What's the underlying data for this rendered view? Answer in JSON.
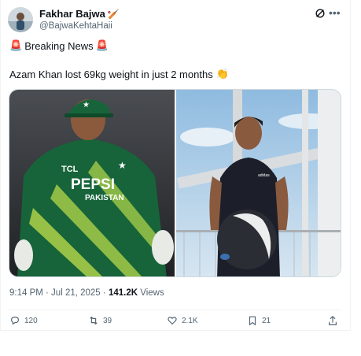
{
  "author": {
    "display_name": "Fakhar Bajwa",
    "handle": "@BajwaKehtaHaii",
    "name_emoji": "🏏"
  },
  "post": {
    "line1_prefix_emoji": "🚨",
    "line1_text": "Breaking News",
    "line1_suffix_emoji": "🚨",
    "line2_text": "Azam Khan lost 69kg weight in just 2 months",
    "line2_emoji": "👏",
    "timestamp": "9:14 PM · Jul 21, 2025",
    "separator": "·",
    "views_count": "141.2K",
    "views_label": "Views"
  },
  "actions": {
    "reply_count": "120",
    "repost_count": "39",
    "like_count": "2.1K",
    "bookmark_count": "21"
  },
  "media": {
    "left_alt": "Cricketer in green PEPSI PAKISTAN kit with wicketkeeping gloves",
    "left_jersey_brand": "PEPSI",
    "left_jersey_team": "PAKISTAN",
    "left_jersey_sponsor": "TCL",
    "right_alt": "Man in black sleeveless top holding a medicine ball",
    "right_shirt_brand": "adidas"
  },
  "colors": {
    "text_primary": "#0f1419",
    "text_secondary": "#536471",
    "border": "#cfd9de",
    "jersey_green": "#17643a",
    "jersey_lime": "#b6d84a"
  }
}
